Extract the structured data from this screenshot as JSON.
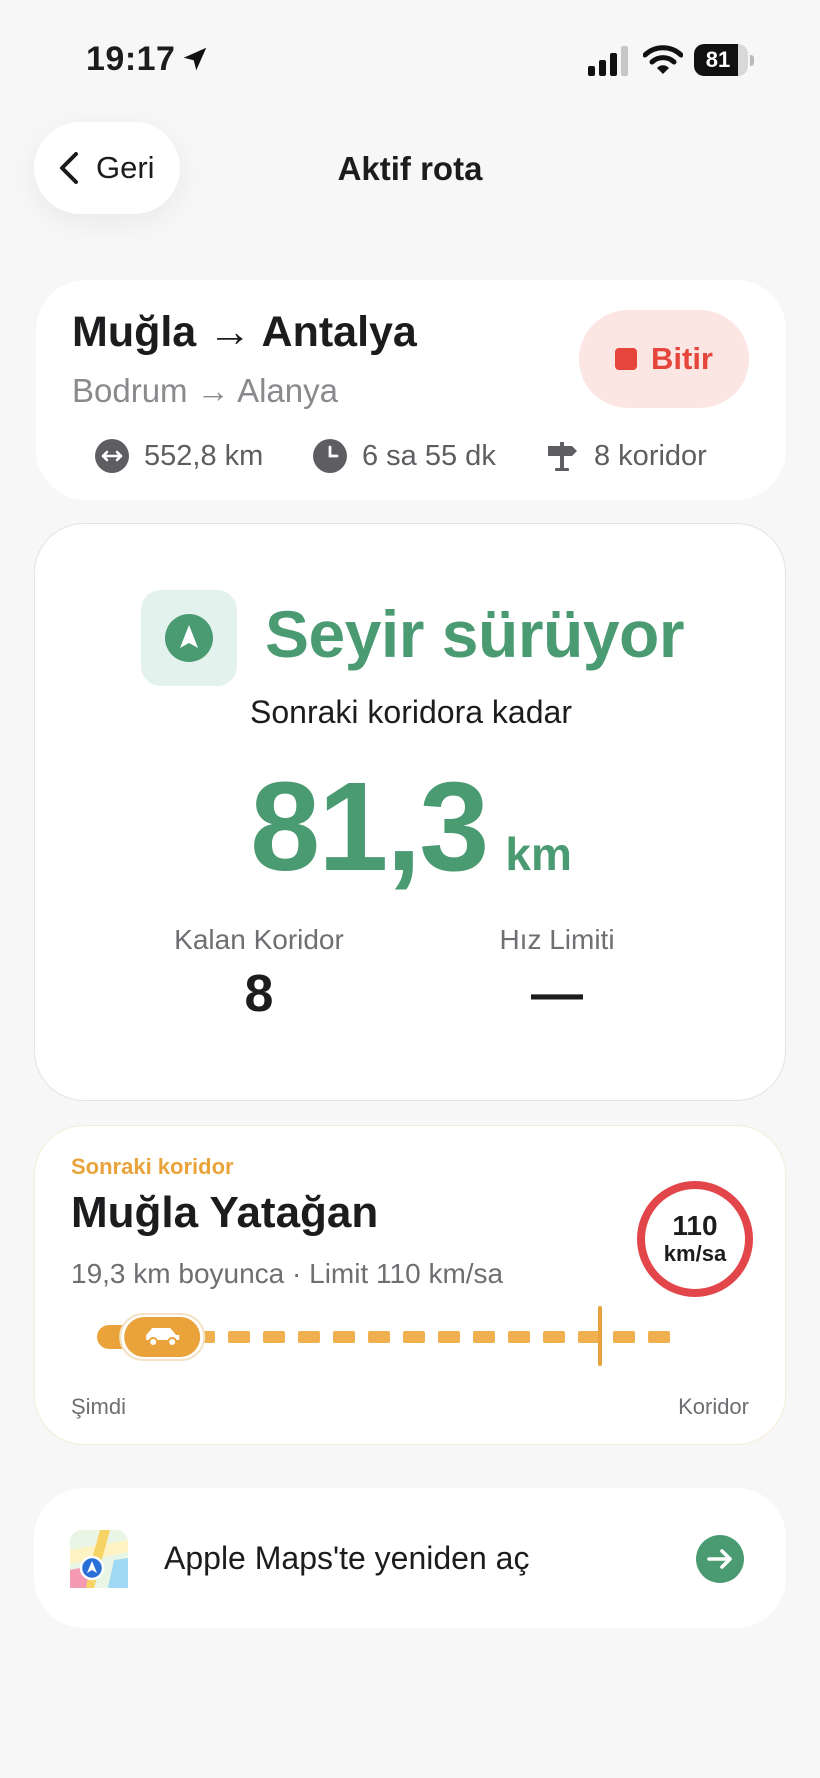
{
  "status_bar": {
    "time": "19:17",
    "battery": "81",
    "battery_level": 0.81
  },
  "nav": {
    "back_label": "Geri",
    "title": "Aktif rota"
  },
  "route": {
    "title": "Muğla → Antalya",
    "subtitle": "Bodrum → Alanya",
    "stop_label": "Bitir",
    "distance": "552,8 km",
    "duration": "6 sa 55 dk",
    "corridors": "8 koridor"
  },
  "status": {
    "heading": "Seyir sürüyor",
    "subheading": "Sonraki koridora kadar",
    "distance_value": "81,3",
    "distance_unit": "km",
    "remaining_label": "Kalan Koridor",
    "remaining_value": "8",
    "speed_label": "Hız Limiti",
    "speed_value": "—"
  },
  "next_corridor": {
    "label": "Sonraki koridor",
    "name": "Muğla Yatağan",
    "detail": "19,3 km boyunca · Limit 110 km/sa",
    "limit_value": "110",
    "limit_unit": "km/sa",
    "start_label": "Şimdi",
    "end_label": "Koridor",
    "progress": 0.05
  },
  "maps_link": {
    "label": "Apple Maps'te yeniden aç"
  },
  "colors": {
    "accent_green": "#4a9a72",
    "stop_red": "#e5453a",
    "corridor_orange": "#e9a33a",
    "limit_red": "#e2464a"
  }
}
